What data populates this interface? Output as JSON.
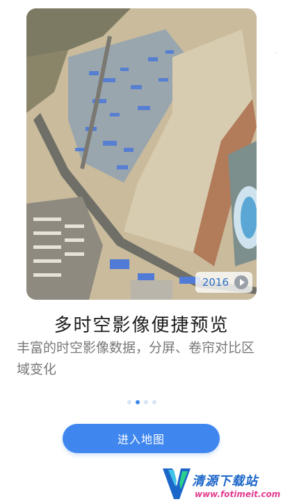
{
  "preview": {
    "year": "2016",
    "play_icon": "play-icon"
  },
  "onboarding": {
    "title": "多时空影像便捷预览",
    "description": "丰富的时空影像数据，分屏、卷帘对比区域变化",
    "page_index": 2,
    "page_count": 4
  },
  "actions": {
    "enter_label": "进入地图"
  },
  "watermark": {
    "name": "清源下载站",
    "url": "www.fotimeit.com"
  },
  "colors": {
    "accent": "#3f87ef",
    "title": "#1a1a1a",
    "description": "#777777",
    "year_text": "#2e6fc7"
  }
}
